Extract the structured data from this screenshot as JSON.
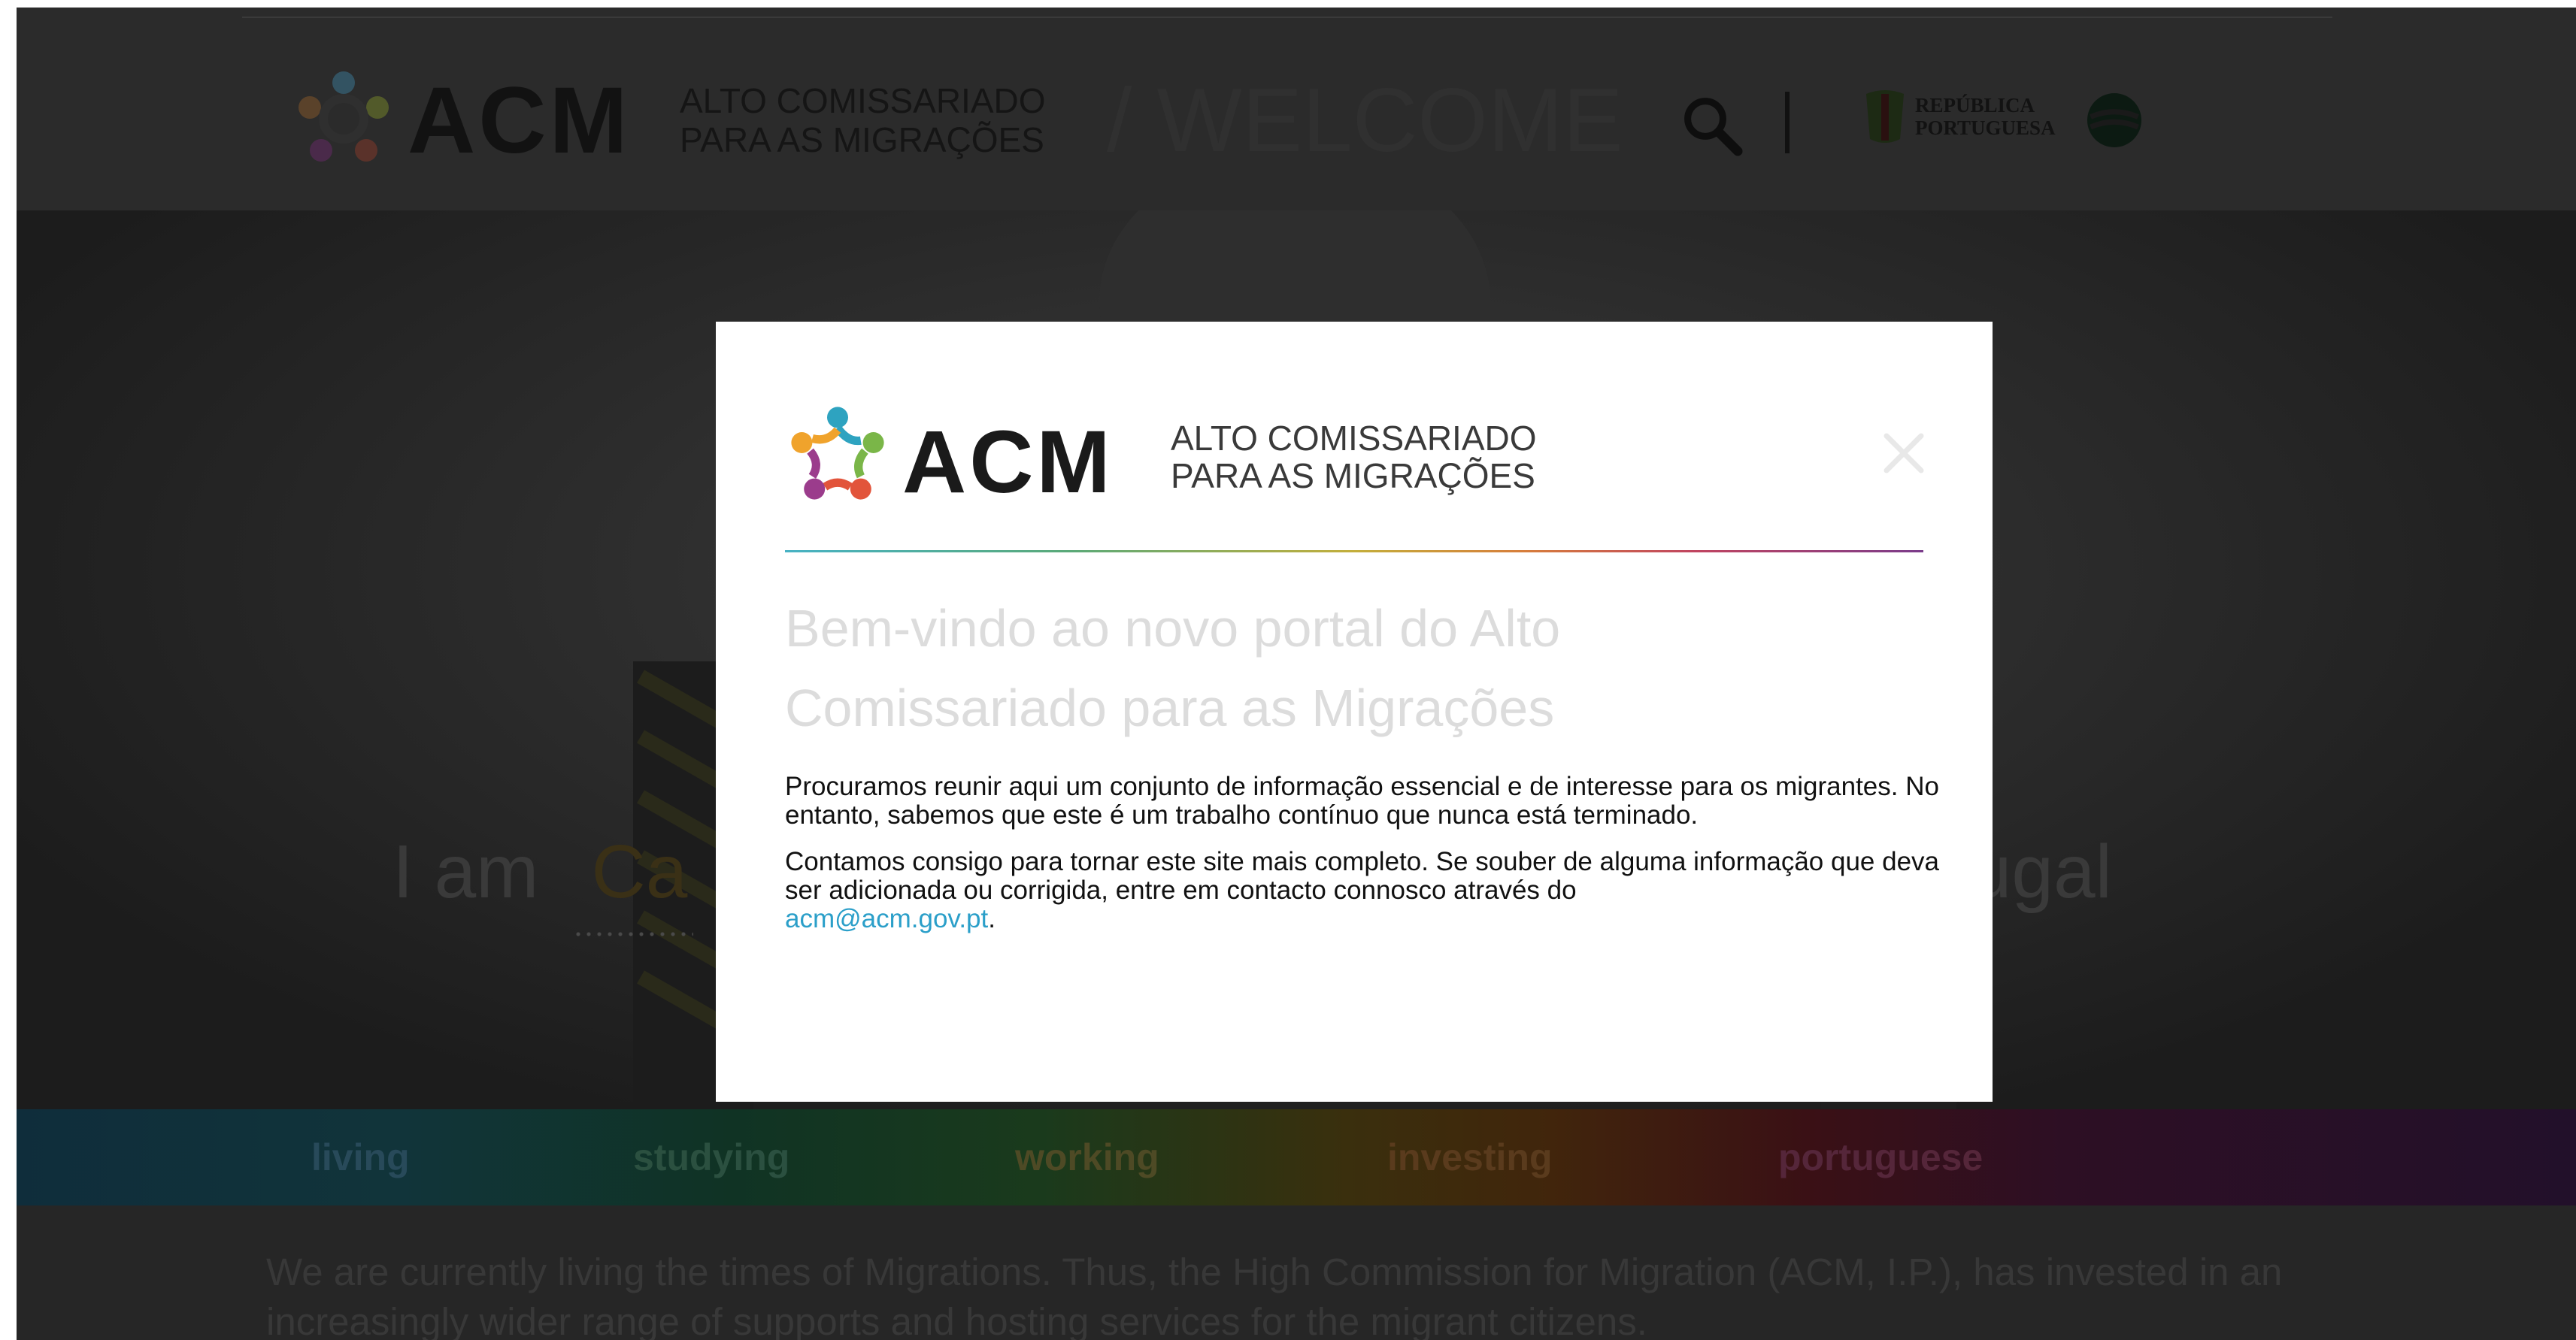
{
  "header": {
    "logo_text": "ACM",
    "org_line1": "ALTO COMISSARIADO",
    "org_line2": "PARA AS MIGRAÇÕES",
    "page_title": "/ WELCOME",
    "republic_line1": "REPÚBLICA",
    "republic_line2": "PORTUGUESA",
    "gov_icon": "government-emblem-icon",
    "search_icon": "search-icon"
  },
  "hero": {
    "word1": "I am",
    "word2": "Ca",
    "word3": "tugal"
  },
  "tabs": [
    {
      "label": "living"
    },
    {
      "label": "studying"
    },
    {
      "label": "working"
    },
    {
      "label": "investing"
    },
    {
      "label": "portuguese"
    }
  ],
  "intro": {
    "text": "We are currently living the times of Migrations. Thus, the High Commission for Migration (ACM, I.P.), has invested in an increasingly wider range of supports and hosting services for the migrant citizens."
  },
  "modal": {
    "logo_text": "ACM",
    "org_line1": "ALTO COMISSARIADO",
    "org_line2": "PARA AS MIGRAÇÕES",
    "title": "Bem-vindo ao novo portal do Alto Comissariado para as Migrações",
    "paragraph1": "Procuramos reunir aqui um conjunto de informação essencial e de interesse para os migrantes. No entanto, sabemos que este é um trabalho contínuo que nunca está terminado.",
    "paragraph2": "Contamos consigo para tornar este site mais completo. Se souber de alguma informação que deva ser adicionada ou corrigida, entre em contacto connosco através do",
    "email": "acm@acm.gov.pt",
    "period": "."
  },
  "colors": {
    "overlay": "#262626",
    "link": "#2b9fc9",
    "title_gray": "#dcdcdc"
  }
}
